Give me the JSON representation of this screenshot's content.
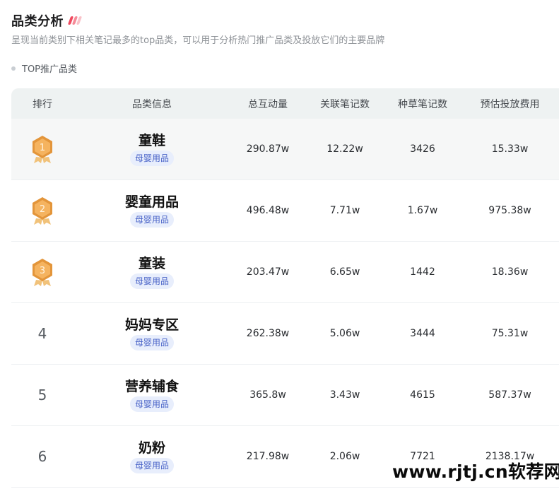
{
  "header": {
    "title": "品类分析",
    "accent_colors": [
      "#f04a5f",
      "#f58a97",
      "#f9c2c9"
    ],
    "subtitle": "呈现当前类别下相关笔记最多的top品类，可以用于分析热门推广品类及投放它们的主要品牌",
    "section_label": "TOP推广品类"
  },
  "table": {
    "columns": [
      "排行",
      "品类信息",
      "总互动量",
      "关联笔记数",
      "种草笔记数",
      "预估投放费用"
    ],
    "rows": [
      {
        "rank": "1",
        "name": "童鞋",
        "tag": "母婴用品",
        "interaction": "290.87w",
        "notes": "12.22w",
        "grass": "3426",
        "cost": "15.33w",
        "medal": "medal-gold-icon"
      },
      {
        "rank": "2",
        "name": "婴童用品",
        "tag": "母婴用品",
        "interaction": "496.48w",
        "notes": "7.71w",
        "grass": "1.67w",
        "cost": "975.38w",
        "medal": "medal-silver-icon"
      },
      {
        "rank": "3",
        "name": "童装",
        "tag": "母婴用品",
        "interaction": "203.47w",
        "notes": "6.65w",
        "grass": "1442",
        "cost": "18.36w",
        "medal": "medal-bronze-icon"
      },
      {
        "rank": "4",
        "name": "妈妈专区",
        "tag": "母婴用品",
        "interaction": "262.38w",
        "notes": "5.06w",
        "grass": "3444",
        "cost": "75.31w"
      },
      {
        "rank": "5",
        "name": "营养辅食",
        "tag": "母婴用品",
        "interaction": "365.8w",
        "notes": "3.43w",
        "grass": "4615",
        "cost": "587.37w"
      },
      {
        "rank": "6",
        "name": "奶粉",
        "tag": "母婴用品",
        "interaction": "217.98w",
        "notes": "2.06w",
        "grass": "7721",
        "cost": "2138.17w"
      }
    ]
  },
  "watermark": "www.rjtj.cn软荐网",
  "colors": {
    "medal_fill": "#f5b35f",
    "medal_edge": "#e3953a",
    "tag_text": "#4a64c8",
    "tag_bg": "#e8eefc"
  }
}
